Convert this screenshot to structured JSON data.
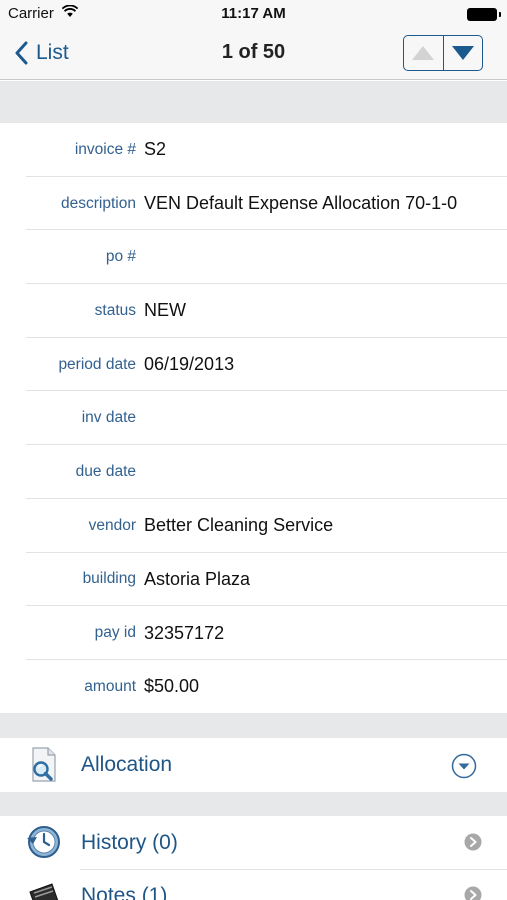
{
  "status_bar": {
    "carrier": "Carrier",
    "time": "11:17 AM"
  },
  "nav": {
    "back_label": "List",
    "title": "1 of 50",
    "up_icon": "triangle-up-icon",
    "down_icon": "triangle-down-icon"
  },
  "fields": [
    {
      "label": "invoice #",
      "value": "S2"
    },
    {
      "label": "description",
      "value": "VEN Default Expense Allocation 70-1-0"
    },
    {
      "label": "po #",
      "value": ""
    },
    {
      "label": "status",
      "value": "NEW"
    },
    {
      "label": "period date",
      "value": "06/19/2013"
    },
    {
      "label": "inv date",
      "value": ""
    },
    {
      "label": "due date",
      "value": ""
    },
    {
      "label": "vendor",
      "value": "Better Cleaning Service"
    },
    {
      "label": "building",
      "value": "Astoria Plaza"
    },
    {
      "label": "pay id",
      "value": "32357172"
    },
    {
      "label": "amount",
      "value": "$50.00"
    }
  ],
  "sections": {
    "allocation": {
      "label": "Allocation",
      "icon": "magnifier-document-icon",
      "accessory": "chevron-down-circle-icon"
    },
    "history": {
      "label": "History (0)",
      "icon": "clock-history-icon",
      "accessory": "chevron-right-circle-icon"
    },
    "notes": {
      "label": "Notes (1)",
      "icon": "notepad-icon",
      "accessory": "chevron-right-circle-icon"
    }
  },
  "colors": {
    "accent": "#1b5a8f",
    "label": "#33618f",
    "band": "#e6e8ea"
  }
}
